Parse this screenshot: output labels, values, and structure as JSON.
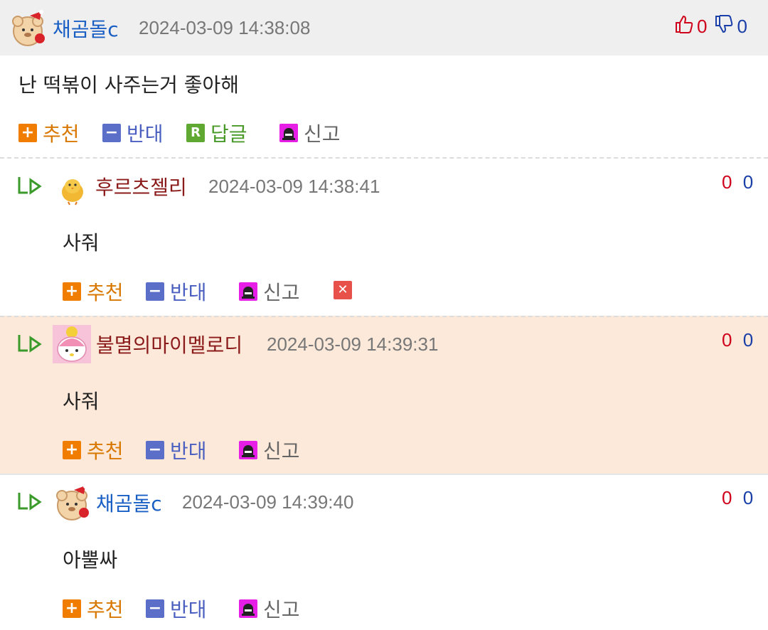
{
  "comments": [
    {
      "author": "채곰돌c",
      "date": "2024-03-09 14:38:08",
      "text": "난 떡볶이 사주는거 좋아해",
      "up": "0",
      "down": "0",
      "actions": {
        "recommend": "추천",
        "oppose": "반대",
        "reply": "답글",
        "report": "신고"
      }
    },
    {
      "author": "후르츠젤리",
      "date": "2024-03-09 14:38:41",
      "text": "사줘",
      "up": "0",
      "down": "0",
      "actions": {
        "recommend": "추천",
        "oppose": "반대",
        "report": "신고"
      }
    },
    {
      "author": "불멸의마이멜로디",
      "date": "2024-03-09 14:39:31",
      "text": "사줘",
      "up": "0",
      "down": "0",
      "actions": {
        "recommend": "추천",
        "oppose": "반대",
        "report": "신고"
      }
    },
    {
      "author": "채곰돌c",
      "date": "2024-03-09 14:39:40",
      "text": "아뿔싸",
      "up": "0",
      "down": "0",
      "actions": {
        "recommend": "추천",
        "oppose": "반대",
        "report": "신고"
      }
    }
  ],
  "icons": {
    "plus": "+",
    "minus": "−",
    "reply": "R",
    "delete": "✕"
  },
  "colors": {
    "highlight_bg": "#fce9d9",
    "header_bg": "#efefef",
    "recommend": "#f07d00",
    "oppose": "#5b6fc8",
    "reply": "#5fa832",
    "report": "#e61ee6"
  }
}
